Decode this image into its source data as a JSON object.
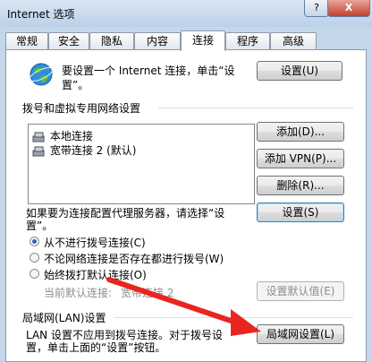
{
  "window": {
    "title": "Internet 选项",
    "help_label": "?",
    "close_label": "X"
  },
  "tabs": [
    {
      "label": "常规"
    },
    {
      "label": "安全"
    },
    {
      "label": "隐私"
    },
    {
      "label": "内容"
    },
    {
      "label": "连接"
    },
    {
      "label": "程序"
    },
    {
      "label": "高级"
    }
  ],
  "setup": {
    "line1": "要设置一个 Internet 连接，单击“设",
    "line2": "置”。",
    "button": "设置(U)"
  },
  "dialup": {
    "section_label": "拨号和虚拟专用网络设置",
    "items": [
      {
        "label": "本地连接"
      },
      {
        "label": "宽带连接 2 (默认)"
      }
    ],
    "add_button": "添加(D)...",
    "add_vpn_button": "添加 VPN(P)...",
    "delete_button": "删除(R)...",
    "proxy_line1": "如果要为连接配置代理服务器，请选择“设",
    "proxy_line2": "置”。",
    "settings_button": "设置(S)",
    "radio_never": "从不进行拨号连接(C)",
    "radio_when_no_network": "不论网络连接是否存在都进行拨号(W)",
    "radio_always": "始终拨打默认连接(O)",
    "current_default_label": "当前默认连接:",
    "current_default_value": "宽带连接 2",
    "set_default_button": "设置默认值(E)"
  },
  "lan": {
    "section_label": "局域网(LAN)设置",
    "line1": "LAN 设置不应用到拨号连接。对于拨号设",
    "line2": "置，单击上面的“设置”按钮。",
    "button": "局域网设置(L)"
  },
  "colors": {
    "arrow": "#e8261f",
    "accent": "#3c7fb1"
  }
}
